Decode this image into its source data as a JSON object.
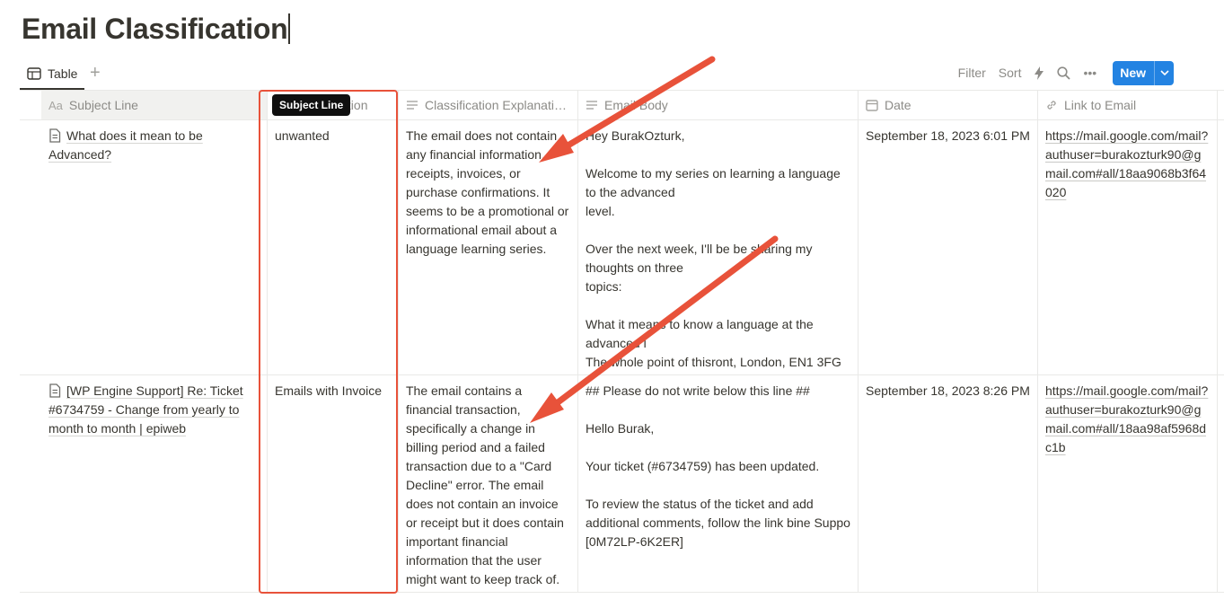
{
  "page": {
    "title": "Email Classification"
  },
  "view": {
    "tab_label": "Table",
    "add_label": "+"
  },
  "toolbar": {
    "filter": "Filter",
    "sort": "Sort",
    "more": "•••",
    "new_label": "New"
  },
  "columns": [
    {
      "label": "Subject Line",
      "icon": "Aa"
    },
    {
      "label": "Classification",
      "icon": "select-icon"
    },
    {
      "label": "Classification Explanati…",
      "icon": "text-icon"
    },
    {
      "label": "Email Body",
      "icon": "text-icon"
    },
    {
      "label": "Date",
      "icon": "calendar-icon"
    },
    {
      "label": "Link to Email",
      "icon": "link-icon"
    }
  ],
  "tooltip": "Subject Line",
  "rows": [
    {
      "subject": "What does it mean to be Advanced?",
      "classification": "unwanted",
      "explanation": "The email does not contain any financial information, receipts, invoices, or purchase confirmations. It seems to be a promotional or informational email about a language learning series.",
      "body": "Hey BurakOzturk,\n\nWelcome to my series on learning a language to the advanced\nlevel.\n\nOver the next week, I'll be be sharing my thoughts on three\ntopics:\n\nWhat it means to know a language at the advanced l\nThe whole point of thisront, London, EN1 3FG",
      "date": "September 18, 2023 6:01 PM",
      "link": "https://mail.google.com/mail?authuser=burakozturk90@gmail.com#all/18aa9068b3f64020"
    },
    {
      "subject": "[WP Engine Support] Re: Ticket #6734759 - Change from yearly to month to month | epiweb",
      "classification": "Emails with Invoice",
      "explanation": "The email contains a financial transaction, specifically a change in billing period and a failed transaction due to a \"Card Decline\" error. The email does not contain an invoice or receipt but it does contain important financial information that the user might want to keep track of.",
      "body": "## Please do not write below this line ##\n\nHello Burak,\n\nYour ticket (#6734759) has been updated.\n\nTo review the status of the ticket and add additional comments, follow the link bine Suppo\n[0M72LP-6K2ER]",
      "date": "September 18, 2023 8:26 PM",
      "link": "https://mail.google.com/mail?authuser=burakozturk90@gmail.com#all/18aa98af5968dc1b"
    }
  ],
  "colors": {
    "accent": "#2383e2",
    "annotation": "#e8523a",
    "text": "#37352f",
    "muted": "#8c8b87"
  }
}
